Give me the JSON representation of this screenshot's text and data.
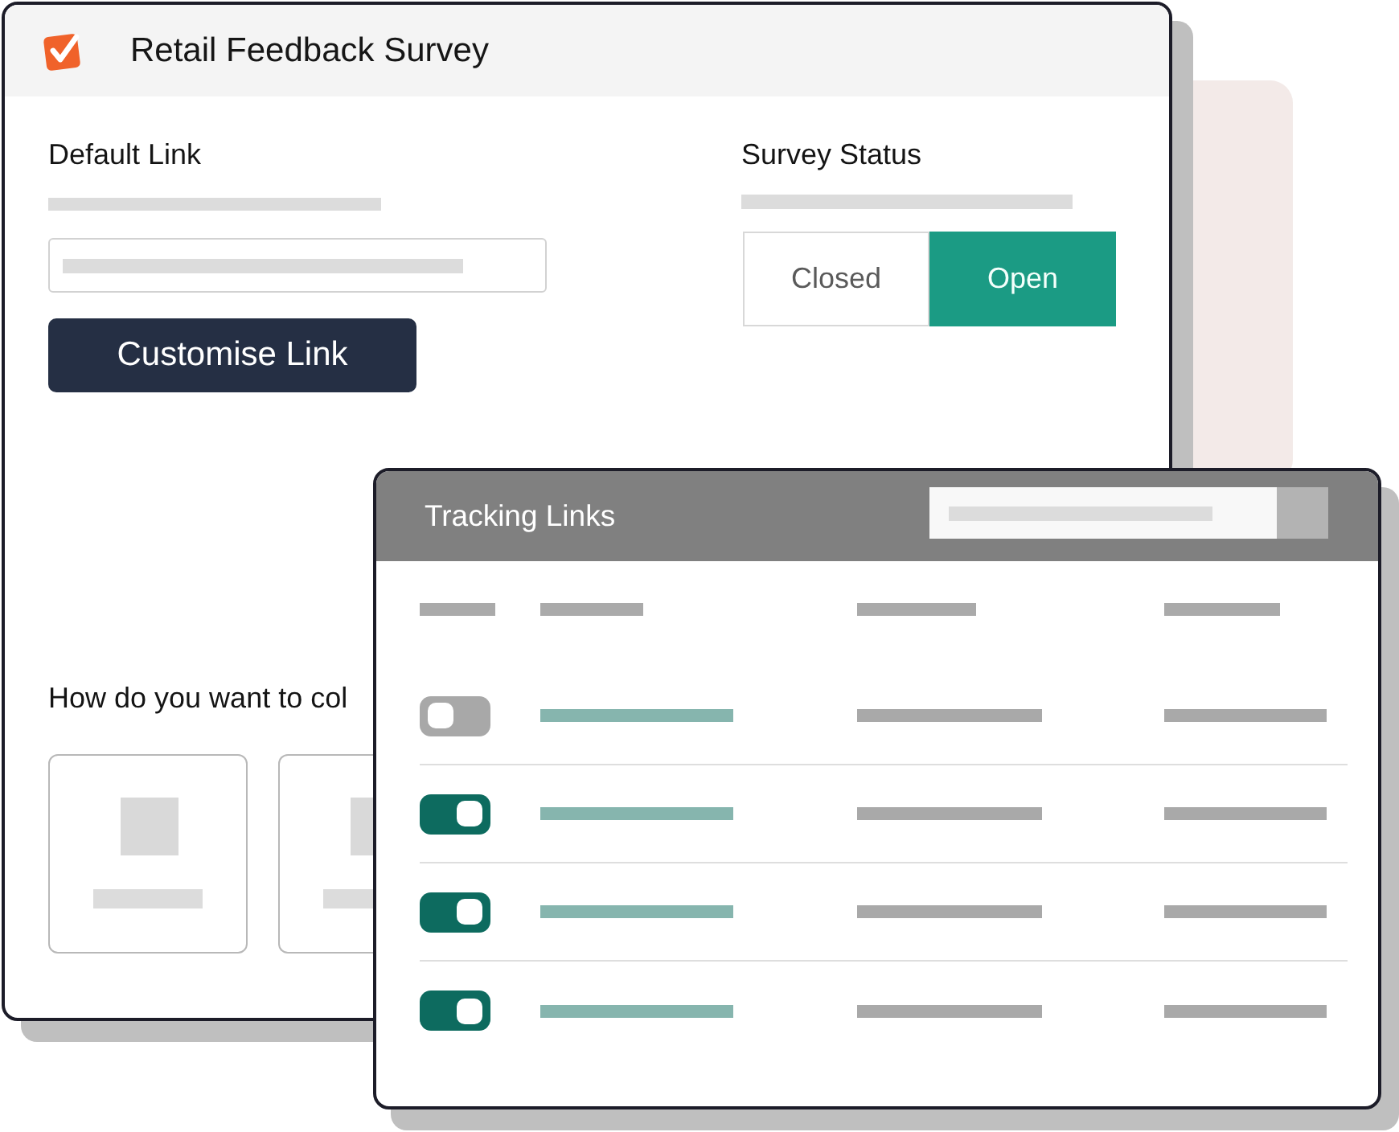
{
  "survey_window": {
    "title": "Retail Feedback Survey",
    "default_link": {
      "label": "Default Link",
      "button": "Customise Link"
    },
    "survey_status": {
      "label": "Survey Status",
      "options": [
        {
          "label": "Closed",
          "selected": false
        },
        {
          "label": "Open",
          "selected": true
        }
      ]
    },
    "collection": {
      "question": "How do you want to col"
    }
  },
  "tracking_links": {
    "title": "Tracking Links",
    "rows": [
      {
        "on": false
      },
      {
        "on": true
      },
      {
        "on": true
      },
      {
        "on": true
      }
    ]
  }
}
